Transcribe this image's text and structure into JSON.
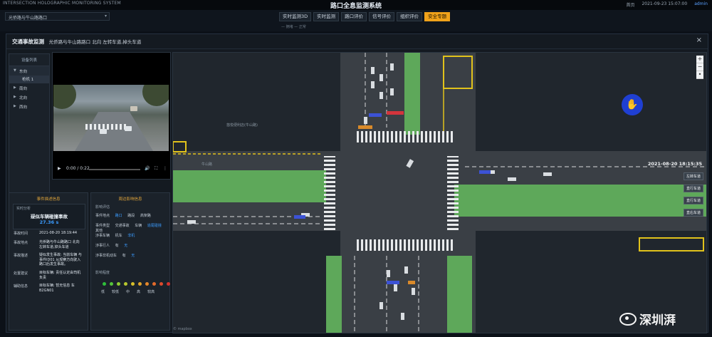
{
  "header": {
    "system_en": "INTERSECTION HOLOGRAPHIC MONITORING SYSTEM",
    "system_cn": "路口全息监测系统",
    "home": "首页",
    "datetime": "2021-09-23 15:07:00",
    "user": "admin"
  },
  "nav": {
    "intersection_select": "光侨路与牛山路路口",
    "tabs": [
      {
        "label": "实时监测3D",
        "active": false
      },
      {
        "label": "实时监测",
        "active": false
      },
      {
        "label": "路口评价",
        "active": false
      },
      {
        "label": "信号评价",
        "active": false
      },
      {
        "label": "组织评价",
        "active": false
      },
      {
        "label": "安全专题",
        "active": true
      }
    ],
    "legend_text": "— 拥堵  — 正常"
  },
  "modal": {
    "title": "交通事故监测",
    "subtitle": "光侨路与牛山路路口 北向 左转车道,掉头车道",
    "close": "×"
  },
  "direction_panel": {
    "header": "设备列表",
    "items": [
      {
        "label": "东向",
        "selected": true,
        "sub": "枪机 1"
      },
      {
        "label": "南向",
        "selected": false
      },
      {
        "label": "北向",
        "selected": false
      },
      {
        "label": "西向",
        "selected": false
      }
    ]
  },
  "video": {
    "time": "0:00 / 0:22",
    "play": "▶",
    "volume": "🔊",
    "fullscreen": "⛶",
    "more": "⋮"
  },
  "event_card": {
    "header": "事件描述信息",
    "realtime_label": "实时分析",
    "status": "疑似车辆碰撞事故",
    "duration": "27.36 s",
    "rows": [
      {
        "k": "事故时间",
        "v": "2021-08-20 18:19:44"
      },
      {
        "k": "事故地点",
        "v": "光侨路与牛山路路口 北向 左转车道,掉头车道"
      },
      {
        "k": "事故描述",
        "v": "疑似发生事故: 当前车辆 与 事件ID01 从观察方向驶入路口后发生事故。"
      },
      {
        "k": "处置建议",
        "v": "目标车辆: 责任认定由司机负责"
      },
      {
        "k": "辅助信息",
        "v": "目标车辆: 暂无信息 车 B2GN01"
      }
    ]
  },
  "env_card": {
    "header": "周边影响信息",
    "sec1": "影响评估",
    "rows": [
      {
        "k": "事件地点",
        "vals": [
          "路口",
          "路段",
          "高架路"
        ],
        "hl": 0
      },
      {
        "k": "事件类型",
        "vals": [
          "交通事故",
          "车辆",
          "追尾碰撞",
          "其他"
        ],
        "hl": 2
      },
      {
        "k": "涉事车辆",
        "vals": [
          "机车",
          "非机"
        ],
        "hl": 1
      },
      {
        "k": "涉事行人",
        "vals": [
          "有",
          "无"
        ],
        "hl": 1
      },
      {
        "k": "涉事非机动车",
        "vals": [
          "有",
          "无"
        ],
        "hl": 1
      }
    ],
    "sec2": "影响程度",
    "levels": [
      "低",
      "较低",
      "中",
      "高",
      "较高"
    ],
    "dot_colors": [
      "#2fbf3a",
      "#56c43a",
      "#8fca33",
      "#b8c72f",
      "#d7bf2b",
      "#e0a42a",
      "#e3862a",
      "#e36a2b",
      "#dd4b2d",
      "#d4322d"
    ]
  },
  "map": {
    "timestamp": "2021-08-20 18:15:35",
    "road_labels": [
      "悠悦便利店(牛山路)",
      "牛山路"
    ],
    "lane_tags": [
      "左转车道",
      "直行车道",
      "直行车道",
      "直右车道"
    ],
    "zoom": [
      "+",
      "−",
      "•"
    ],
    "hand_icon": "✋",
    "watermark": "© mapbox"
  },
  "watermark": {
    "text": "深圳湃"
  }
}
